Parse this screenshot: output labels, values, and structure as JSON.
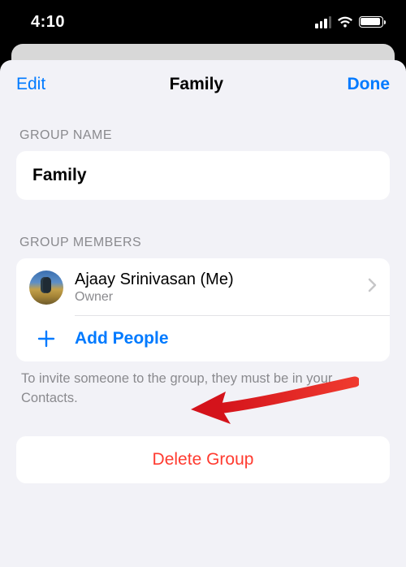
{
  "status": {
    "time": "4:10"
  },
  "nav": {
    "edit": "Edit",
    "title": "Family",
    "done": "Done"
  },
  "sections": {
    "groupNameHeader": "GROUP NAME",
    "groupMembersHeader": "GROUP MEMBERS"
  },
  "groupName": "Family",
  "members": [
    {
      "name": "Ajaay Srinivasan (Me)",
      "role": "Owner"
    }
  ],
  "addPeople": "Add People",
  "inviteNote": "To invite someone to the group, they must be in your Contacts.",
  "deleteGroup": "Delete Group"
}
